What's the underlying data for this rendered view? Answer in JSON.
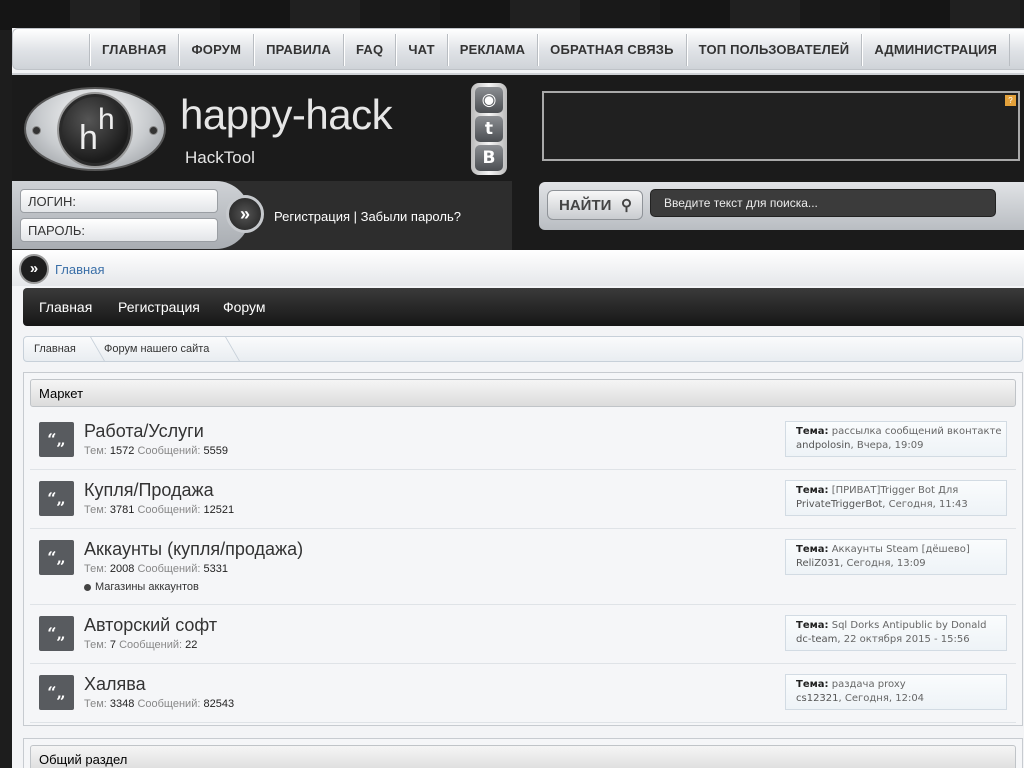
{
  "nav": [
    "ГЛАВНАЯ",
    "ФОРУМ",
    "ПРАВИЛА",
    "FAQ",
    "ЧАТ",
    "РЕКЛАМА",
    "ОБРАТНАЯ СВЯЗЬ",
    "ТОП ПОЛЬЗОВАТЕЛЕЙ",
    "АДМИНИСТРАЦИЯ"
  ],
  "site": {
    "title": "happy-hack",
    "subtitle": "HackTool",
    "logo_text": "hh"
  },
  "social": [
    "rss-icon",
    "tumblr-icon",
    "vk-icon"
  ],
  "social_glyphs": [
    "◉",
    "t",
    "B"
  ],
  "login": {
    "login_label": "ЛОГИН:",
    "password_label": "ПАРОЛЬ:",
    "go": "»",
    "links": "Регистрация | Забыли пароль?"
  },
  "search": {
    "button": "НАЙТИ",
    "placeholder": "Введите текст для поиска..."
  },
  "breadcrumb_top": "Главная",
  "forum_nav": [
    "Главная",
    "Регистрация",
    "Форум"
  ],
  "crumbs": [
    "Главная",
    "Форум нашего сайта"
  ],
  "sections": [
    {
      "title": "Маркет",
      "forums": [
        {
          "name": "Работа/Услуги",
          "topics": "1572",
          "posts": "5559",
          "sub": "",
          "last_topic": "рассылка сообщений вконтакте",
          "last_user": "andpolosin",
          "last_date": "Вчера, 19:09"
        },
        {
          "name": "Купля/Продажа",
          "topics": "3781",
          "posts": "12521",
          "sub": "",
          "last_topic": "[ПРИВАТ]Trigger Bot Для",
          "last_user": "PrivateTriggerBot",
          "last_date": "Сегодня, 11:43"
        },
        {
          "name": "Аккаунты (купля/продажа)",
          "topics": "2008",
          "posts": "5331",
          "sub": "Магазины аккаунтов",
          "last_topic": "Аккаунты Steam [дёшево]",
          "last_user": "ReliZ031",
          "last_date": "Сегодня, 13:09"
        },
        {
          "name": "Авторский софт",
          "topics": "7",
          "posts": "22",
          "sub": "",
          "last_topic": "Sql Dorks Antipublic by Donald",
          "last_user": "dc-team",
          "last_date": "22 октября 2015 - 15:56"
        },
        {
          "name": "Халява",
          "topics": "3348",
          "posts": "82543",
          "sub": "",
          "last_topic": "раздача proxy",
          "last_user": "cs12321",
          "last_date": "Сегодня, 12:04"
        }
      ]
    },
    {
      "title": "Общий раздел",
      "forums": []
    }
  ],
  "labels": {
    "topics": "Тем:",
    "posts": "Сообщений:",
    "theme": "Тема:",
    "quote_glyph": "“„"
  }
}
